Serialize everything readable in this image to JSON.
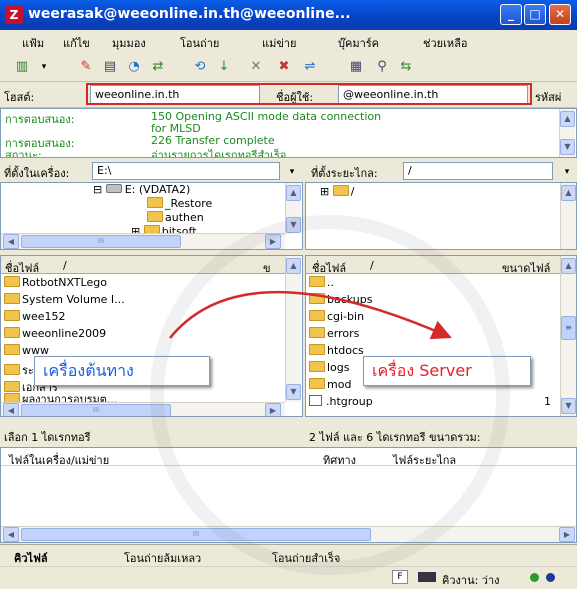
{
  "window": {
    "title": "weerasak@weeonline.in.th@weeonline...",
    "minimize": "_",
    "maximize": "□",
    "close": "✕"
  },
  "menu": [
    "แฟ้ม",
    "แก้ไข",
    "มุมมอง",
    "โอนถ่าย",
    "แม่ข่าย",
    "บุ๊คมาร์ค",
    "ช่วยเหลือ"
  ],
  "quickconnect": {
    "host_label": "โฮสต์:",
    "host_value": "weeonline.in.th",
    "user_label": "ชื่อผู้ใช้:",
    "user_value": "@weeonline.in.th",
    "pass_label": "รหัสผ่"
  },
  "log": [
    {
      "label": "การตอบสนอง:",
      "msg1": "150 Opening ASCII mode data connection",
      "msg2": "for MLSD"
    },
    {
      "label": "การตอบสนอง:",
      "msg1": "226 Transfer complete",
      "msg2": ""
    },
    {
      "label": "สถานะ:",
      "msg1": "อ่านรายการไดเรกทอรีสำเร็จ",
      "msg2": ""
    }
  ],
  "local": {
    "site_label": "ที่ตั้งในเครื่อง:",
    "site_value": "E:\\",
    "tree": [
      {
        "label": "E: (VDATA2)",
        "kind": "drive"
      },
      {
        "label": "_Restore"
      },
      {
        "label": "authen"
      },
      {
        "label": "bitsoft"
      }
    ],
    "col_name": "ชื่อไฟล์",
    "col_size": "ข",
    "files": [
      "RotbotNXTLego",
      "System Volume I...",
      "wee152",
      "weeonline2009",
      "www",
      "ระบบ",
      "เอกสาร",
      "ผลงานการอบรมต..."
    ],
    "status": "เลือก 1 ไดเรกทอรี"
  },
  "remote": {
    "site_label": "ที่ตั้งระยะไกล:",
    "site_value": "/",
    "tree_root": "/",
    "col_name": "ชื่อไฟล์",
    "col_size": "ขนาดไฟล์",
    "files": [
      "..",
      "backups",
      "cgi-bin",
      "errors",
      "htdocs",
      "logs",
      "mod",
      ".htgroup"
    ],
    "file_size_last": "1",
    "status": "2 ไฟล์ และ 6 ไดเรกทอรี ขนาดรวม:"
  },
  "callouts": {
    "local": "เครื่องต้นทาง",
    "remote": "เครื่อง Server"
  },
  "queue": {
    "col_local": "ไฟล์ในเครื่อง/แม่ข่าย",
    "col_direction": "ทิศทาง",
    "col_remote": "ไฟล์ระยะไกล"
  },
  "tabs": [
    "คิวไฟล์",
    "โอนถ่ายล้มเหลว",
    "โอนถ่ายสำเร็จ"
  ],
  "footer": {
    "queue_status": "คิวงาน: ว่าง"
  },
  "colors": {
    "callout_local": "#1a5fe0",
    "callout_remote": "#e0242a",
    "highlight_box": "#d6282b",
    "arrow": "#d42a2a",
    "log_text": "#1a8a1a"
  }
}
